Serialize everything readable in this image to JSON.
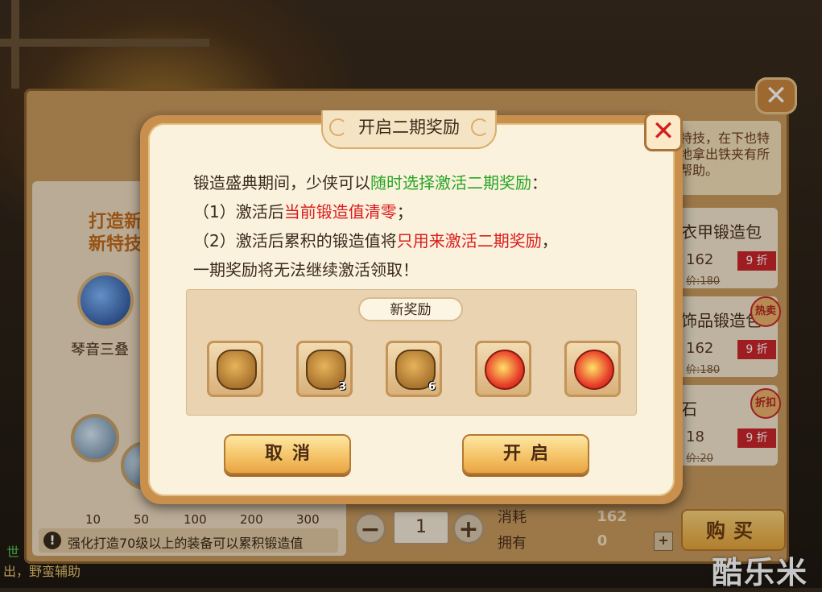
{
  "background": {
    "npc_speech": "特技，在下也特地拿出铁夹有所帮助。",
    "left_title": "打造新新特技",
    "skill_name": "琴音三叠",
    "scale_ticks": [
      "10",
      "50",
      "100",
      "200",
      "300"
    ],
    "notice": "强化打造70级以上的装备可以累积锻造值",
    "shop_items": [
      {
        "name": "衣甲锻造包",
        "price": "162",
        "discount": "9 折",
        "old_price": "价:180"
      },
      {
        "name": "饰品锻造包",
        "price": "162",
        "discount": "9 折",
        "old_price": "价:180"
      },
      {
        "name": "石",
        "price": "18",
        "discount": "9 折",
        "old_price": "价:20"
      }
    ],
    "tags": {
      "hot": "热卖",
      "discount": "折扣"
    },
    "quantity": "1",
    "cost_label": "消耗",
    "cost_value": "162",
    "own_label": "拥有",
    "own_value": "0",
    "buy_label": "购买",
    "chat_text": "世",
    "chat_line": "出，野蛮辅助",
    "watermark": "酷乐米"
  },
  "dialog": {
    "title": "开启二期奖励",
    "line1_a": "锻造盛典期间，少侠可以",
    "line1_b": "随时选择激活二期奖励",
    "line1_c": "：",
    "line2_a": "（1）激活后",
    "line2_b": "当前锻造值清零",
    "line2_c": "；",
    "line3_a": "（2）激活后累积的锻造值将",
    "line3_b": "只用来激活二期奖励",
    "line3_c": "，",
    "line4": "一期奖励将无法继续激活领取！",
    "reward_label": "新奖励",
    "rewards": [
      {
        "icon": "forge-pouch-icon",
        "count": ""
      },
      {
        "icon": "forge-pouch-icon",
        "count": "3"
      },
      {
        "icon": "forge-pouch-icon",
        "count": "6"
      },
      {
        "icon": "gift-bag-icon",
        "count": ""
      },
      {
        "icon": "gift-bag-icon",
        "count": ""
      }
    ],
    "cancel_label": "取消",
    "confirm_label": "开启",
    "close_symbol": "✕"
  },
  "colors": {
    "highlight_green": "#27a523",
    "highlight_red": "#db1c1c"
  }
}
